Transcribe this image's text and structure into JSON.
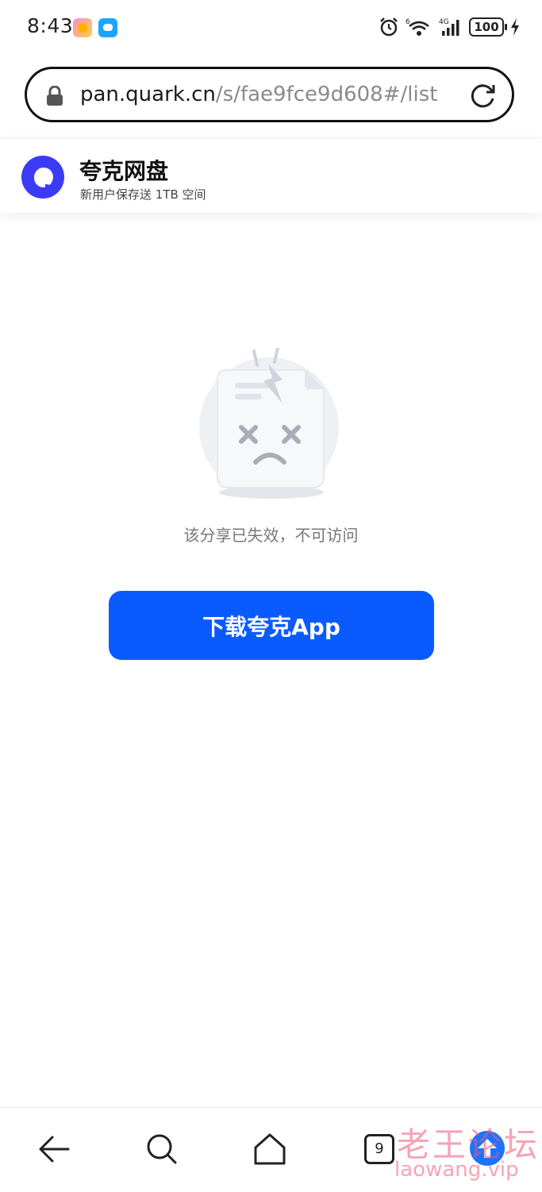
{
  "status_bar": {
    "time": "8:43",
    "battery": "100",
    "notif_icons": [
      "game-app-icon",
      "message-app-icon"
    ],
    "right_icons": [
      "alarm-icon",
      "wifi-icon",
      "signal-4g-icon",
      "battery-icon",
      "charging-icon"
    ],
    "wifi_label": "6",
    "network_label": "4G"
  },
  "browser": {
    "url_host": "pan.quark.cn",
    "url_path": "/s/fae9fce9d608#/list"
  },
  "site_header": {
    "brand_name": "夸克网盘",
    "tagline": "新用户保存送 1TB 空间"
  },
  "main": {
    "expired_message": "该分享已失效，不可访问",
    "download_button": "下载夸克App"
  },
  "bottom_nav": {
    "tab_count": "9",
    "items": [
      "back-icon",
      "search-icon",
      "home-icon",
      "tabs-icon",
      "upload-icon"
    ]
  },
  "watermark": {
    "cn": "老王论坛",
    "en": "laowang.vip"
  },
  "colors": {
    "accent": "#0a5bff",
    "logo": "#3b3bf5",
    "muted_text": "#777777"
  }
}
